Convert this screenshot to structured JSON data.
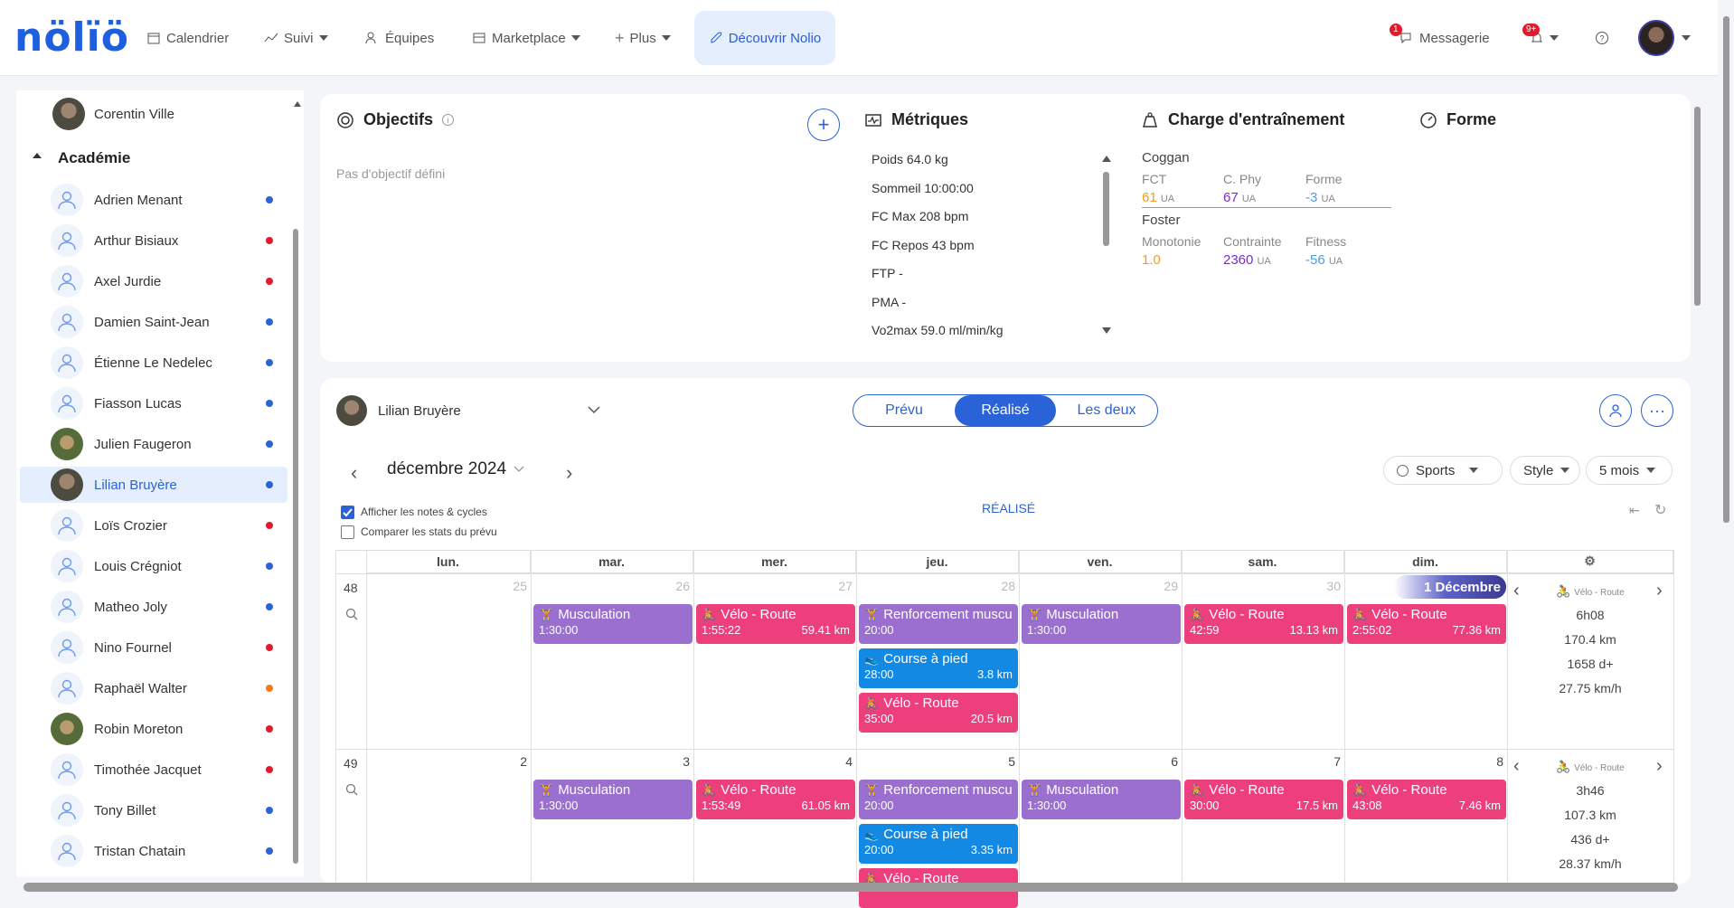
{
  "brand": {
    "logo": "nölïö",
    "accent": "#1e5fe0"
  },
  "nav": {
    "calendrier": "Calendrier",
    "suivi": "Suivi",
    "equipes": "Équipes",
    "marketplace": "Marketplace",
    "plus": "Plus",
    "decouvrir": "Découvrir Nolio",
    "messagerie": "Messagerie",
    "messagerie_badge": "1",
    "notif_badge": "9+"
  },
  "sidebar": {
    "top_user": "Corentin Ville",
    "group": "Académie",
    "athletes": [
      {
        "name": "Adrien Menant",
        "dot": "#2a63d8"
      },
      {
        "name": "Arthur Bisiaux",
        "dot": "#e21a2b"
      },
      {
        "name": "Axel Jurdie",
        "dot": "#e21a2b"
      },
      {
        "name": "Damien Saint-Jean",
        "dot": "#2a63d8"
      },
      {
        "name": "Étienne Le Nedelec",
        "dot": "#2a63d8"
      },
      {
        "name": "Fiasson Lucas",
        "dot": "#2a63d8"
      },
      {
        "name": "Julien Faugeron",
        "dot": "#2a63d8"
      },
      {
        "name": "Lilian Bruyère",
        "dot": "#2a63d8"
      },
      {
        "name": "Loïs Crozier",
        "dot": "#e21a2b"
      },
      {
        "name": "Louis Crégniot",
        "dot": "#2a63d8"
      },
      {
        "name": "Matheo Joly",
        "dot": "#2a63d8"
      },
      {
        "name": "Nino Fournel",
        "dot": "#e21a2b"
      },
      {
        "name": "Raphaël Walter",
        "dot": "#f27c1f"
      },
      {
        "name": "Robin Moreton",
        "dot": "#e21a2b"
      },
      {
        "name": "Timothée Jacquet",
        "dot": "#e21a2b"
      },
      {
        "name": "Tony Billet",
        "dot": "#2a63d8"
      },
      {
        "name": "Tristan Chatain",
        "dot": "#2a63d8"
      }
    ]
  },
  "objectifs": {
    "title": "Objectifs",
    "empty": "Pas d'objectif défini"
  },
  "metriques": {
    "title": "Métriques",
    "items": [
      "Poids 64.0 kg",
      "Sommeil 10:00:00",
      "FC Max 208 bpm",
      "FC Repos 43 bpm",
      "FTP -",
      "PMA -",
      "Vo2max 59.0 ml/min/kg"
    ]
  },
  "charge": {
    "title": "Charge d'entraînement",
    "coggan": "Coggan",
    "fct_l": "FCT",
    "fct_v": "61",
    "cphy_l": "C. Phy",
    "cphy_v": "67",
    "forme_l": "Forme",
    "forme_v": "-3",
    "foster": "Foster",
    "mono_l": "Monotonie",
    "mono_v": "1.0",
    "contr_l": "Contrainte",
    "contr_v": "2360",
    "fit_l": "Fitness",
    "fit_v": "-56",
    "ua": "UA"
  },
  "forme": {
    "title": "Forme"
  },
  "athlete_select": "Lilian Bruyère",
  "toggle": {
    "prevu": "Prévu",
    "realise": "Réalisé",
    "deux": "Les deux"
  },
  "month": "décembre 2024",
  "filters": {
    "sports": "Sports",
    "style": "Style",
    "range": "5 mois"
  },
  "mode_label": "RÉALISÉ",
  "checks": {
    "notes": "Afficher les notes & cycles",
    "compare": "Comparer les stats du prévu"
  },
  "days": [
    "lun.",
    "mar.",
    "mer.",
    "jeu.",
    "ven.",
    "sam.",
    "dim."
  ],
  "weeks": [
    {
      "num": "48",
      "dates": [
        "25",
        "26",
        "27",
        "28",
        "29",
        "30",
        ""
      ],
      "chip": "1 Décembre",
      "summary": {
        "sport": "Vélo - Route",
        "time": "6h08",
        "dist": "170.4 km",
        "elev": "1658 d+",
        "speed": "27.75 km/h"
      },
      "events": [
        {
          "day": 1,
          "row": 0,
          "type": "muscu",
          "title": "Musculation",
          "dur": "1:30:00",
          "dist": ""
        },
        {
          "day": 2,
          "row": 0,
          "type": "velo",
          "title": "Vélo - Route",
          "dur": "1:55:22",
          "dist": "59.41 km"
        },
        {
          "day": 3,
          "row": 0,
          "type": "renfo",
          "title": "Renforcement muscu",
          "dur": "20:00",
          "dist": ""
        },
        {
          "day": 3,
          "row": 1,
          "type": "course",
          "title": "Course à pied",
          "dur": "28:00",
          "dist": "3.8 km"
        },
        {
          "day": 3,
          "row": 2,
          "type": "velo",
          "title": "Vélo - Route",
          "dur": "35:00",
          "dist": "20.5 km"
        },
        {
          "day": 4,
          "row": 0,
          "type": "muscu",
          "title": "Musculation",
          "dur": "1:30:00",
          "dist": ""
        },
        {
          "day": 5,
          "row": 0,
          "type": "velo",
          "title": "Vélo - Route",
          "dur": "42:59",
          "dist": "13.13 km"
        },
        {
          "day": 6,
          "row": 0,
          "type": "velo",
          "title": "Vélo - Route",
          "dur": "2:55:02",
          "dist": "77.36 km"
        }
      ]
    },
    {
      "num": "49",
      "dates": [
        "",
        "2",
        "3",
        "4",
        "5",
        "6",
        "7",
        "8"
      ],
      "summary": {
        "sport": "Vélo - Route",
        "time": "3h46",
        "dist": "107.3 km",
        "elev": "436 d+",
        "speed": "28.37 km/h"
      },
      "events": [
        {
          "day": 1,
          "row": 0,
          "type": "muscu",
          "title": "Musculation",
          "dur": "1:30:00",
          "dist": ""
        },
        {
          "day": 2,
          "row": 0,
          "type": "velo",
          "title": "Vélo - Route",
          "dur": "1:53:49",
          "dist": "61.05 km"
        },
        {
          "day": 3,
          "row": 0,
          "type": "renfo",
          "title": "Renforcement muscu",
          "dur": "20:00",
          "dist": ""
        },
        {
          "day": 3,
          "row": 1,
          "type": "course",
          "title": "Course à pied",
          "dur": "20:00",
          "dist": "3.35 km"
        },
        {
          "day": 3,
          "row": 2,
          "type": "velo",
          "title": "Vélo - Route",
          "dur": "",
          "dist": ""
        },
        {
          "day": 4,
          "row": 0,
          "type": "muscu",
          "title": "Musculation",
          "dur": "1:30:00",
          "dist": ""
        },
        {
          "day": 5,
          "row": 0,
          "type": "velo",
          "title": "Vélo - Route",
          "dur": "30:00",
          "dist": "17.5 km"
        },
        {
          "day": 6,
          "row": 0,
          "type": "velo",
          "title": "Vélo - Route",
          "dur": "43:08",
          "dist": "7.46 km"
        }
      ]
    }
  ]
}
